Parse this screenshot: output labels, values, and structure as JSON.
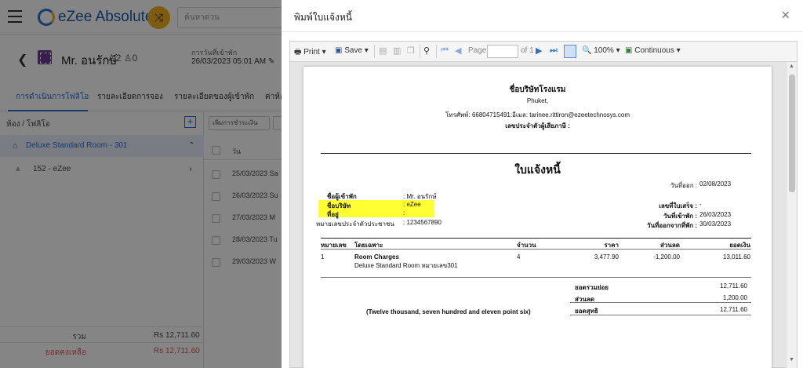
{
  "app": {
    "logo_text": "eZee Absolute",
    "search_placeholder": "ค้นหาด่วน",
    "guest": {
      "name": "Mr. อนรักษ์",
      "adults": "2",
      "children": "0",
      "arrival_label": "การวันที่เข้าพัก",
      "arrival_value": "26/03/2023 05:01 AM"
    },
    "tabs": [
      {
        "label": "การดำเนินการโฟลิโอ",
        "active": true
      },
      {
        "label": "รายละเอียดการจอง"
      },
      {
        "label": "รายละเอียดของผู้เข้าพัก"
      },
      {
        "label": "ค่าห้อ"
      }
    ],
    "left_panel": {
      "header": "ห้อง / โฟลิโอ",
      "room": "Deluxe Standard Room - 301",
      "folio": "152 - eZee",
      "total_label": "รวม",
      "total_value": "Rs 12,711.60",
      "balance_label": "ยอดคงเหลือ",
      "balance_value": "Rs 12,711.60"
    },
    "mid_panel": {
      "button": "เพิ่มการชำระเงิน",
      "header": "วัน",
      "dates": [
        "25/03/2023 Sa",
        "26/03/2023 Su",
        "27/03/2023 M",
        "28/03/2023 Tu",
        "29/03/2023 W"
      ]
    }
  },
  "modal": {
    "title": "พิมพ์ใบแจ้งหนี้",
    "toolbar": {
      "print": "Print",
      "save": "Save",
      "page_label": "Page",
      "of": "of 1",
      "zoom": "100%",
      "mode": "Continuous"
    },
    "invoice": {
      "hotel_name": "ชื่อบริษัทโรงแรม",
      "city": "Phuket,",
      "contact": "โทรศัพท์: 66804715491:อีเมล: tarinee.rittiron@ezeetechnosys.com",
      "tax_id_label": "เลขประจำตัวผู้เสียภาษี :",
      "doc_title": "ใบแจ้งหนี้",
      "issue_date_label": "วันที่ออก :",
      "issue_date": "02/08/2023",
      "guest_name_label": "ชื่อผู้เข้าพัก",
      "guest_name": ": Mr. อนรักษ์",
      "company_label": "ชื่อบริษัท",
      "company": ": eZee",
      "address_label": "ที่อยู่",
      "address": ":",
      "id_label": "หมายเลขประจำตัวประชาชน",
      "id_value": ": 1234567890",
      "receipt_label": "เลขที่ใบเสร็จ :",
      "receipt_value": "-",
      "checkin_label": "วันที่เข้าพัก :",
      "checkin_value": "26/03/2023",
      "checkout_label": "วันที่ออกจากที่พัก :",
      "checkout_value": "30/03/2023",
      "table_headers": [
        "หมายเลข",
        "โดยเฉพาะ",
        "จำนวน",
        "ราคา",
        "ส่วนลด",
        "ยอดเงิน"
      ],
      "rows": [
        {
          "no": "1",
          "item": "Room Charges",
          "item_sub": "Deluxe Standard Room หมายเลข301",
          "qty": "4",
          "price": "3,477.90",
          "discount": "-1,200.00",
          "amount": "13,011.60"
        }
      ],
      "subtotal_label": "ยอดรวมย่อย",
      "subtotal": "12,711.60",
      "discount_label": "ส่วนลด",
      "discount_total": "1,200.00",
      "net_label": "ยอดสุทธิ",
      "net": "12,711.60",
      "amount_words": "(Twelve thousand, seven hundred and eleven point six)"
    }
  },
  "colors": {
    "brand": "#1b5aa8",
    "accent": "#2c6ed1",
    "highlight": "#ffff33",
    "balance_red": "#d9534f"
  }
}
